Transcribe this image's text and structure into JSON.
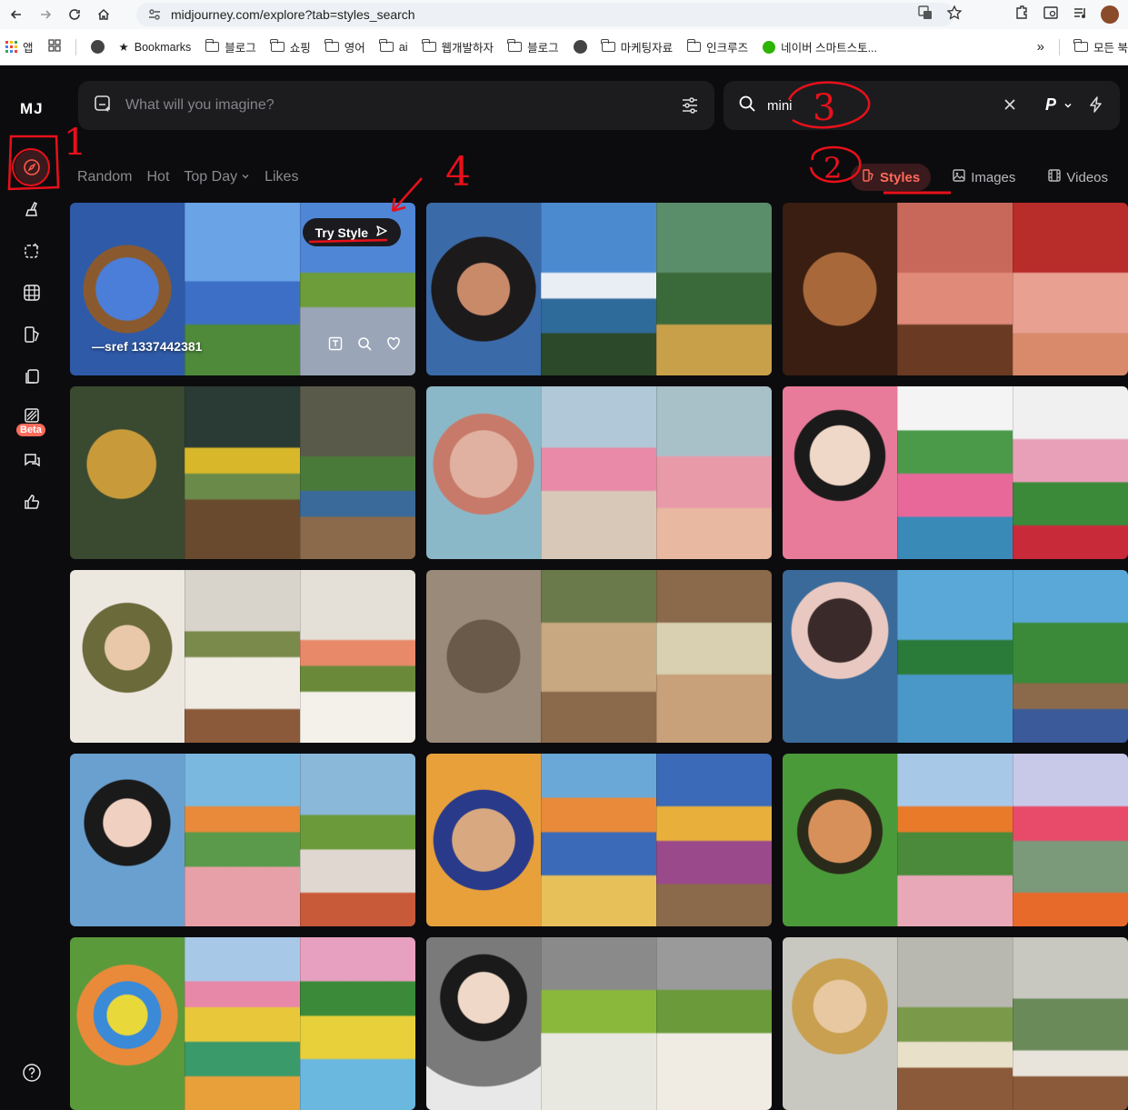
{
  "browser": {
    "url": "midjourney.com/explore?tab=styles_search",
    "bookmarks": [
      "앱",
      "Bookmarks",
      "블로그",
      "쇼핑",
      "영어",
      "ai",
      "웹개발하자",
      "블로그",
      "마케팅자료",
      "인크루즈",
      "네이버 스마트스토..."
    ],
    "overflow_label": "»",
    "all_bookmarks": "모든 북"
  },
  "sidebar": {
    "logo": "MJ",
    "beta": "Beta"
  },
  "prompt": {
    "placeholder": "What will you imagine?"
  },
  "search": {
    "value": "mini",
    "personalize": "P"
  },
  "tabs_left": [
    "Random",
    "Hot",
    "Top Day",
    "Likes"
  ],
  "tabs_right": {
    "styles": "Styles",
    "images": "Images",
    "videos": "Videos"
  },
  "first_card": {
    "try_style": "Try Style",
    "sref": "—sref 1337442381"
  },
  "annotations": [
    "1",
    "2",
    "3",
    "4"
  ],
  "colors": {
    "accent": "#ff5a4e",
    "annotation_red": "#e8101a"
  }
}
